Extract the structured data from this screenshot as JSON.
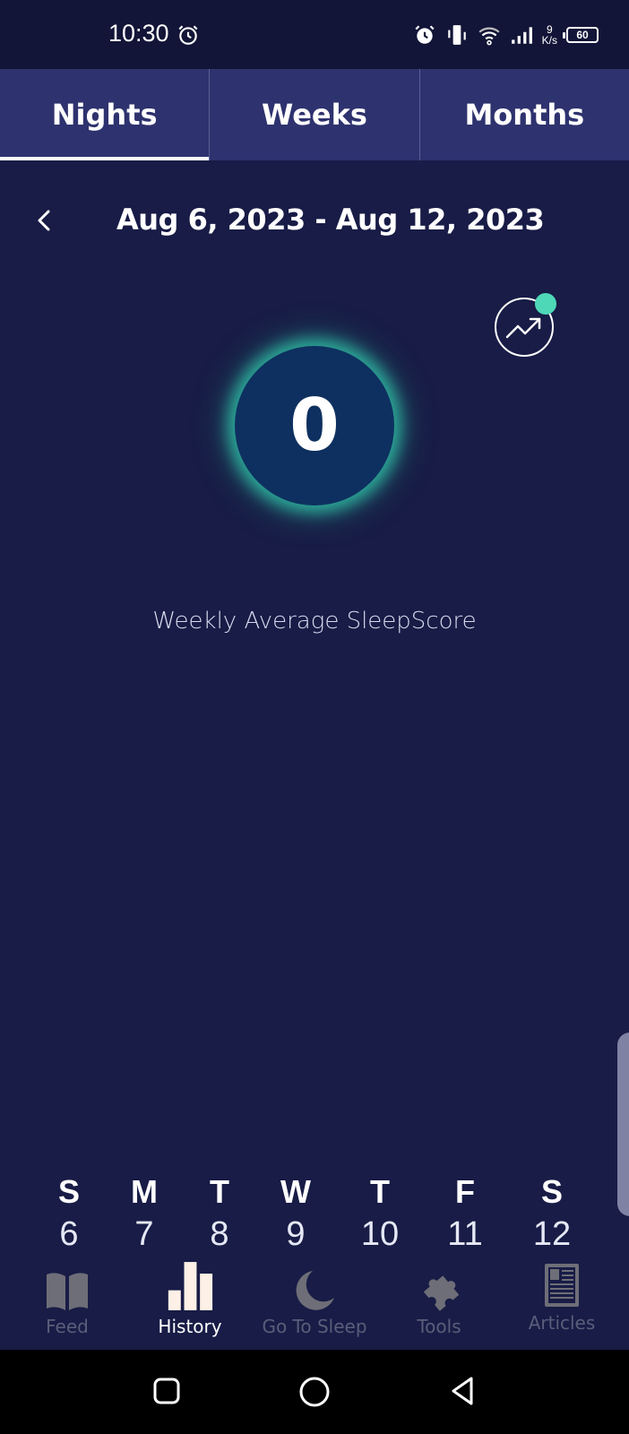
{
  "status_bar": {
    "time": "10:30",
    "net_speed_value": "9",
    "net_speed_unit": "K/s",
    "battery": "60"
  },
  "tabs": [
    {
      "label": "Nights",
      "active": true
    },
    {
      "label": "Weeks",
      "active": false
    },
    {
      "label": "Months",
      "active": false
    }
  ],
  "date_range": "Aug 6, 2023 - Aug 12, 2023",
  "score": {
    "value": "0",
    "label": "Weekly Average SleepScore"
  },
  "days": [
    {
      "letter": "S",
      "num": "6"
    },
    {
      "letter": "M",
      "num": "7"
    },
    {
      "letter": "T",
      "num": "8"
    },
    {
      "letter": "W",
      "num": "9"
    },
    {
      "letter": "T",
      "num": "10"
    },
    {
      "letter": "F",
      "num": "11"
    },
    {
      "letter": "S",
      "num": "12"
    }
  ],
  "bottom_nav": [
    {
      "label": "Feed",
      "icon": "book-icon",
      "active": false
    },
    {
      "label": "History",
      "icon": "bar-chart-icon",
      "active": true
    },
    {
      "label": "Go To Sleep",
      "icon": "moon-icon",
      "active": false
    },
    {
      "label": "Tools",
      "icon": "puzzle-icon",
      "active": false
    },
    {
      "label": "Articles",
      "icon": "newspaper-icon",
      "active": false
    }
  ],
  "colors": {
    "background": "#181c46",
    "tab_bar": "#2e326e",
    "accent_glow": "#4fd8b8",
    "score_circle": "#0e3060",
    "inactive_nav": "#6e6e78",
    "active_nav_icon": "#fdf0e6"
  }
}
